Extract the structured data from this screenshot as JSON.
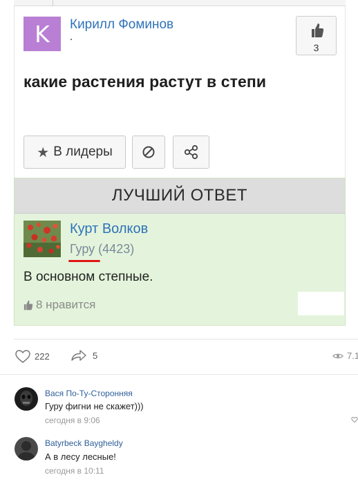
{
  "question": {
    "author_name": "Кирилл Фоминов",
    "author_initial": "K",
    "likes": "3",
    "title": "какие растения растут в степи"
  },
  "actions": {
    "leaders_label": "В лидеры"
  },
  "best_answer": {
    "header": "ЛУЧШИЙ ОТВЕТ",
    "author_name": "Курт Волков",
    "rank": "Гуру",
    "score": "(4423)",
    "text": "В основном степные.",
    "likes": "8 нравится"
  },
  "stats": {
    "likes": "222",
    "shares": "5",
    "views": "7.1"
  },
  "comments": [
    {
      "author": "Вася По-Ту-Сторонняя",
      "text": "Гуру фигни не скажет)))",
      "time": "сегодня в 9:06"
    },
    {
      "author": "Batyrbeck Bayghel​dy",
      "text": "А в лесу лесные!",
      "time": "сегодня в 10:11"
    }
  ],
  "colors": {
    "link": "#2f73b8",
    "best_bg": "#e4f4dc",
    "avatar_bg": "#b97fd4",
    "underline": "#e01515"
  }
}
